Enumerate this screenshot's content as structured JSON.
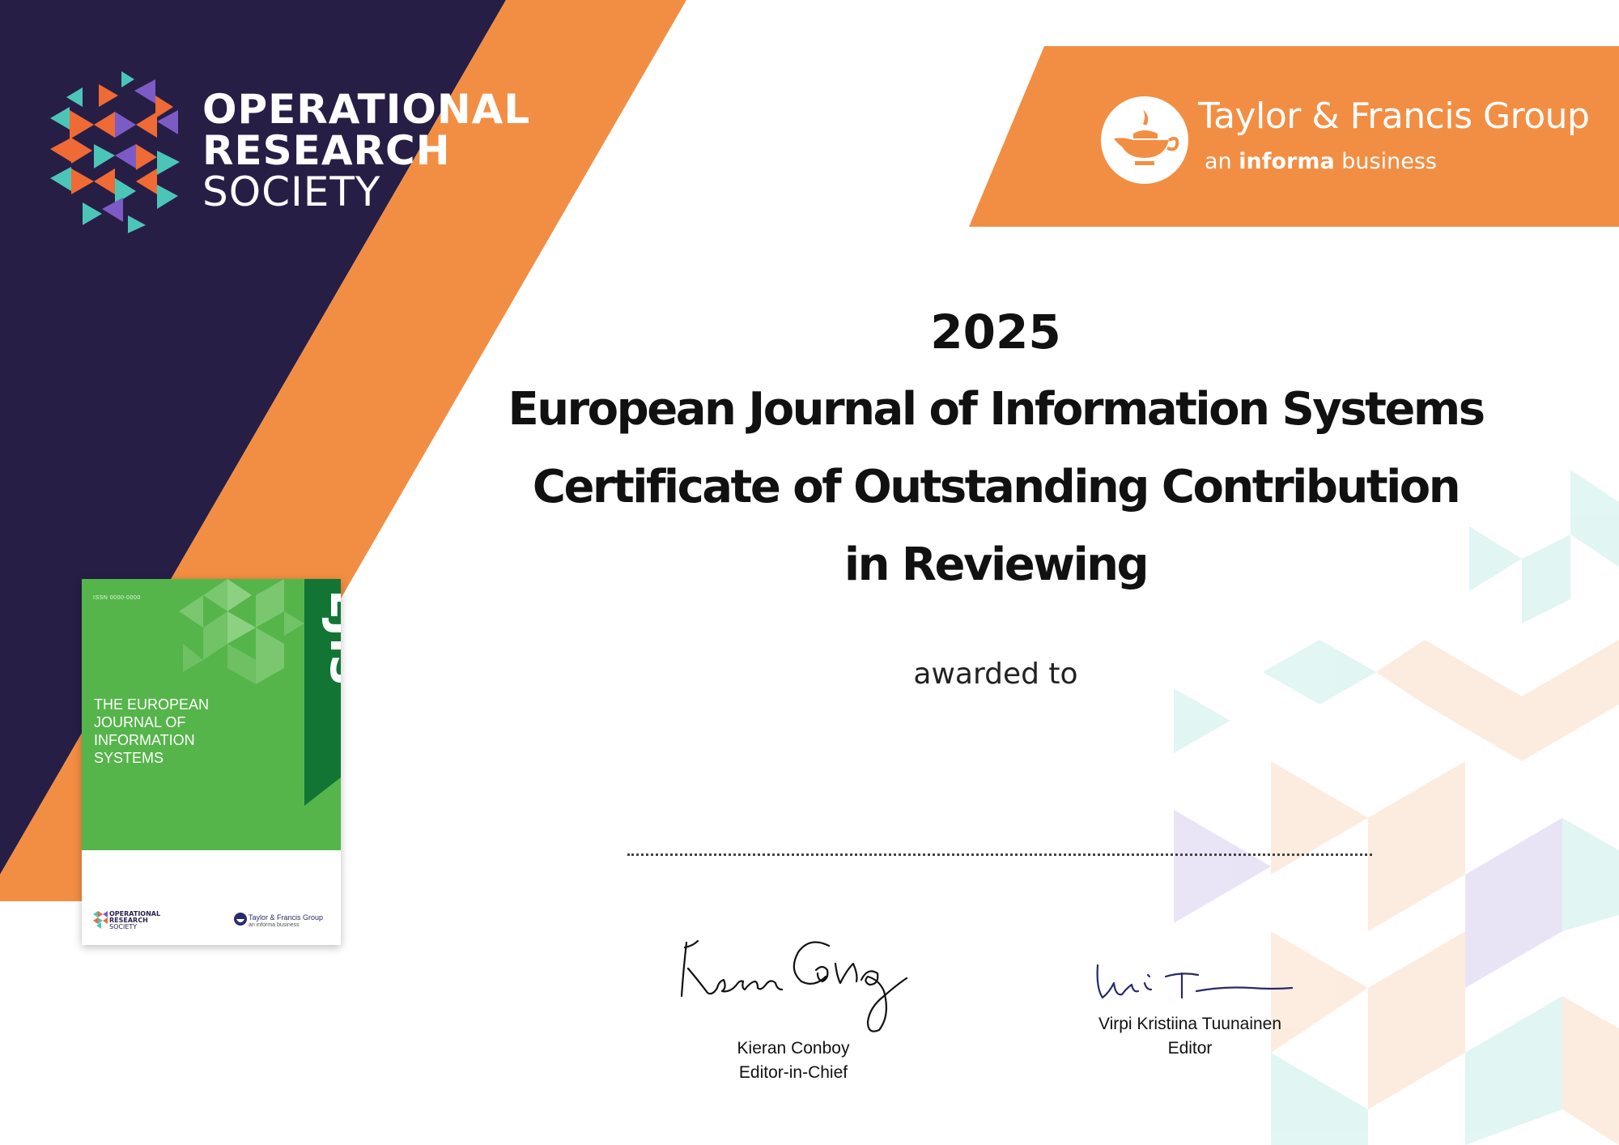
{
  "ors": {
    "line1": "OPERATIONAL",
    "line2": "RESEARCH",
    "line3": "SOCIETY"
  },
  "publisher": {
    "name": "Taylor & Francis Group",
    "tagline_pre": "an ",
    "tagline_bold": "informa",
    "tagline_post": " business"
  },
  "certificate": {
    "year": "2025",
    "line1": "European Journal of Information Systems",
    "line2": "Certificate of Outstanding Contribution",
    "line3": "in Reviewing",
    "awarded_to": "awarded to"
  },
  "signatories": [
    {
      "name": "Kieran Conboy",
      "role": "Editor-in-Chief"
    },
    {
      "name": "Virpi Kristiina Tuunainen",
      "role": "Editor"
    }
  ],
  "journal_cover": {
    "issn": "ISSN 0000-0000",
    "abbreviation": "EJIS",
    "title_lines": [
      "THE EUROPEAN",
      "JOURNAL OF",
      "INFORMATION",
      "SYSTEMS"
    ],
    "ors_lines": [
      "OPERATIONAL",
      "RESEARCH",
      "SOCIETY"
    ],
    "publisher_name": "Taylor & Francis Group",
    "publisher_tagline": "an informa business"
  },
  "colors": {
    "navy": "#271e46",
    "orange": "#f28e43",
    "green": "#55b54a",
    "dark_green": "#137534",
    "teal": "#4cc5b9"
  }
}
